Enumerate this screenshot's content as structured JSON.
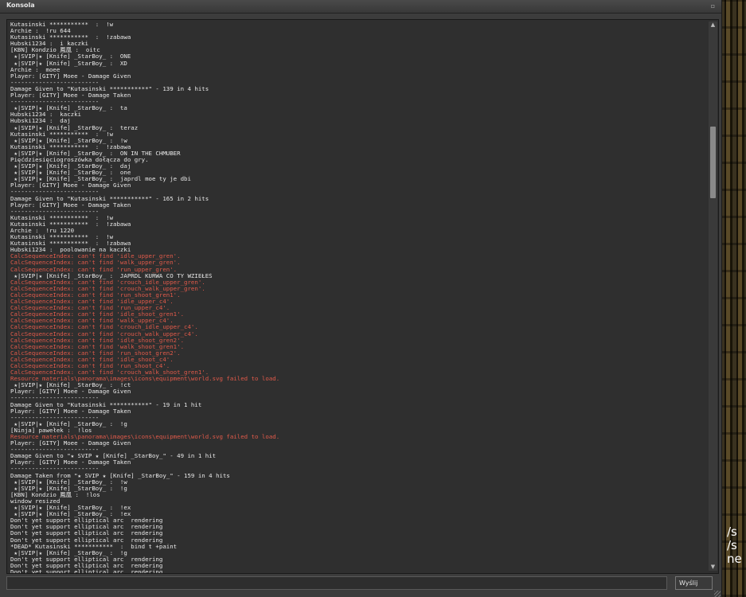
{
  "window": {
    "title": "Konsola",
    "close_glyph": "▫",
    "submit_label": "Wyślij",
    "input_value": ""
  },
  "log": [
    {
      "t": "Kutasinski ***********  :  !w"
    },
    {
      "t": "Archie :  !ru 644"
    },
    {
      "t": "Kutasinski ***********  :  !zabawa"
    },
    {
      "t": "Hubski1234 :  i kaczki"
    },
    {
      "t": "[KBN] Kondzio 鳳凰 :  oitc"
    },
    {
      "t": " ★|SVIP|★ [Knife] _StarBoy_ :  ONE"
    },
    {
      "t": " ★|SVIP|★ [Knife] _StarBoy_ :  XD"
    },
    {
      "t": "Archie :  moee"
    },
    {
      "t": "Player: [GITY] Moee - Damage Given"
    },
    {
      "t": "-------------------------"
    },
    {
      "t": "Damage Given to \"Kutasinski ***********\" - 139 in 4 hits"
    },
    {
      "t": "Player: [GITY] Moee - Damage Taken"
    },
    {
      "t": "-------------------------"
    },
    {
      "t": " ★|SVIP|★ [Knife] _StarBoy_ :  ta"
    },
    {
      "t": "Hubski1234 :  kaczki"
    },
    {
      "t": "Hubski1234 :  daj"
    },
    {
      "t": " ★|SVIP|★ [Knife] _StarBoy_ :  teraz"
    },
    {
      "t": "Kutasinski ***********  :  !w"
    },
    {
      "t": " ★|SVIP|★ [Knife] _StarBoy_ :  !w"
    },
    {
      "t": "Kutasinski ***********  :  !zabawa"
    },
    {
      "t": " ★|SVIP|★ [Knife] _StarBoy_ :  ON IN THE CHMUBER"
    },
    {
      "t": "Pięćdziesięciogroszówka dołącza do gry."
    },
    {
      "t": " ★|SVIP|★ [Knife] _StarBoy_ :  daj"
    },
    {
      "t": " ★|SVIP|★ [Knife] _StarBoy_ :  one"
    },
    {
      "t": " ★|SVIP|★ [Knife] _StarBoy_ :  japrdl moe ty je dbi"
    },
    {
      "t": "Player: [GITY] Moee - Damage Given"
    },
    {
      "t": "-------------------------"
    },
    {
      "t": "Damage Given to \"Kutasinski ***********\" - 165 in 2 hits"
    },
    {
      "t": "Player: [GITY] Moee - Damage Taken"
    },
    {
      "t": "-------------------------"
    },
    {
      "t": "Kutasinski ***********  :  !w"
    },
    {
      "t": "Kutasinski ***********  :  !zabawa"
    },
    {
      "t": "Archie :  !ru 1220"
    },
    {
      "t": "Kutasinski ***********  :  !w"
    },
    {
      "t": "Kutasinski ***********  :  !zabawa"
    },
    {
      "t": "Hubski1234 :  poolowanie na kaczki"
    },
    {
      "t": "CalcSequenceIndex: can't find 'idle_upper_gren'.",
      "err": true
    },
    {
      "t": "CalcSequenceIndex: can't find 'walk_upper_gren'.",
      "err": true
    },
    {
      "t": "CalcSequenceIndex: can't find 'run_upper_gren'.",
      "err": true
    },
    {
      "t": " ★|SVIP|★ [Knife] _StarBoy_ :  JAPRDL KURWA CO TY WZIEŁEŚ"
    },
    {
      "t": "CalcSequenceIndex: can't find 'crouch_idle_upper_gren'.",
      "err": true
    },
    {
      "t": "CalcSequenceIndex: can't find 'crouch_walk_upper_gren'.",
      "err": true
    },
    {
      "t": "CalcSequenceIndex: can't find 'run_shoot_gren1'.",
      "err": true
    },
    {
      "t": "CalcSequenceIndex: can't find 'idle_upper_c4'.",
      "err": true
    },
    {
      "t": "CalcSequenceIndex: can't find 'run_upper_c4'.",
      "err": true
    },
    {
      "t": "CalcSequenceIndex: can't find 'idle_shoot_gren1'.",
      "err": true
    },
    {
      "t": "CalcSequenceIndex: can't find 'walk_upper_c4'.",
      "err": true
    },
    {
      "t": "CalcSequenceIndex: can't find 'crouch_idle_upper_c4'.",
      "err": true
    },
    {
      "t": "CalcSequenceIndex: can't find 'crouch_walk_upper_c4'.",
      "err": true
    },
    {
      "t": "CalcSequenceIndex: can't find 'idle_shoot_gren2'.",
      "err": true
    },
    {
      "t": "CalcSequenceIndex: can't find 'walk_shoot_gren1'.",
      "err": true
    },
    {
      "t": "CalcSequenceIndex: can't find 'run_shoot_gren2'.",
      "err": true
    },
    {
      "t": "CalcSequenceIndex: can't find 'idle_shoot_c4'.",
      "err": true
    },
    {
      "t": "CalcSequenceIndex: can't find 'run_shoot_c4'.",
      "err": true
    },
    {
      "t": "CalcSequenceIndex: can't find 'crouch_walk_shoot_gren1'.",
      "err": true
    },
    {
      "t": "Resource materials\\panorama\\images\\icons\\equipment\\world.svg failed to load.",
      "err": true
    },
    {
      "t": " ★|SVIP|★ [Knife] _StarBoy_ :  !ct"
    },
    {
      "t": "Player: [GITY] Moee - Damage Given"
    },
    {
      "t": "-------------------------"
    },
    {
      "t": "Damage Given to \"Kutasinski ***********\" - 19 in 1 hit"
    },
    {
      "t": "Player: [GITY] Moee - Damage Taken"
    },
    {
      "t": "-------------------------"
    },
    {
      "t": " ★|SVIP|★ [Knife] _StarBoy_ :  !g"
    },
    {
      "t": "[Ninja] pawełek :  !los"
    },
    {
      "t": "Resource materials\\panorama\\images\\icons\\equipment\\world.svg failed to load.",
      "err": true
    },
    {
      "t": "Player: [GITY] Moee - Damage Given"
    },
    {
      "t": "-------------------------"
    },
    {
      "t": "Damage Given to \"★ SVIP ★ [Knife] _StarBoy_\" - 49 in 1 hit"
    },
    {
      "t": "Player: [GITY] Moee - Damage Taken"
    },
    {
      "t": "-------------------------"
    },
    {
      "t": "Damage Taken from \"★ SVIP ★ [Knife] _StarBoy_\" - 159 in 4 hits"
    },
    {
      "t": " ★|SVIP|★ [Knife] _StarBoy_ :  !w"
    },
    {
      "t": " ★|SVIP|★ [Knife] _StarBoy_ :  !g"
    },
    {
      "t": "[KBN] Kondzio 鳳凰 :  !los"
    },
    {
      "t": "window resized"
    },
    {
      "t": " ★|SVIP|★ [Knife] _StarBoy_ :  !ex"
    },
    {
      "t": " ★|SVIP|★ [Knife] _StarBoy_ :  !ex"
    },
    {
      "t": "Don't yet support elliptical arc  rendering"
    },
    {
      "t": "Don't yet support elliptical arc  rendering"
    },
    {
      "t": "Don't yet support elliptical arc  rendering"
    },
    {
      "t": "Don't yet support elliptical arc  rendering"
    },
    {
      "t": "*DEAD* Kutasinski ***********  :  bind t +paint"
    },
    {
      "t": " ★|SVIP|★ [Knife] _StarBoy_ :  !g"
    },
    {
      "t": "Don't yet support elliptical arc  rendering"
    },
    {
      "t": "Don't yet support elliptical arc  rendering"
    },
    {
      "t": "Don't yet support elliptical arc  rendering"
    }
  ],
  "game_overlay": {
    "lines": [
      "/s",
      "/s",
      "ne"
    ]
  },
  "colors": {
    "normal_text": "#e8e8e8",
    "error_text": "#e05a4a",
    "panel_bg": "#2f2f2f"
  }
}
